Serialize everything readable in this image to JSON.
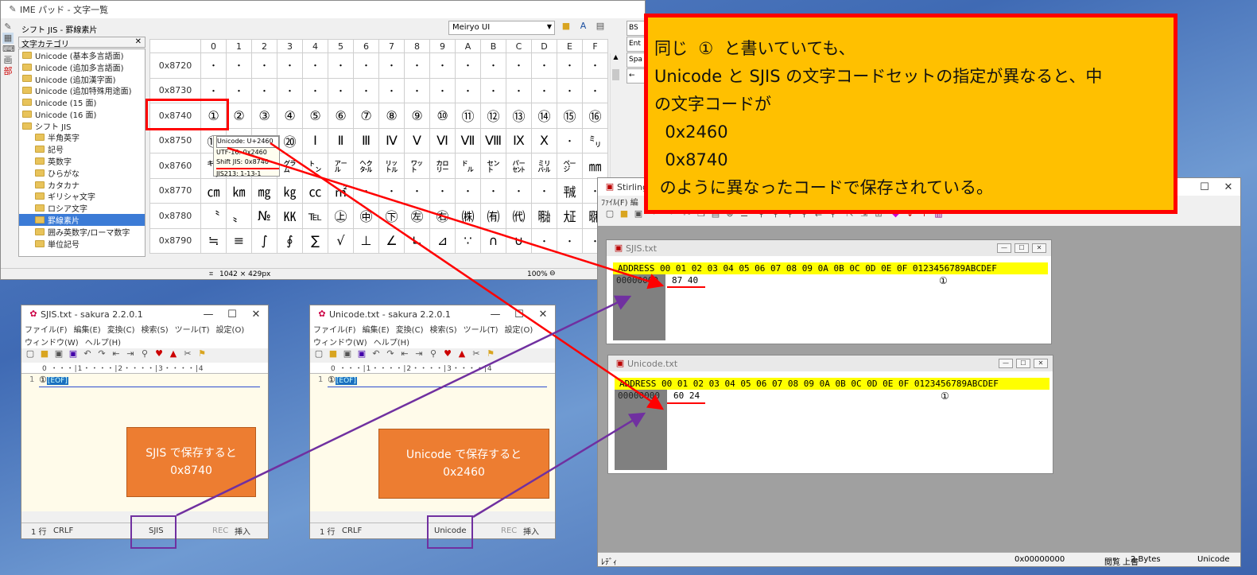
{
  "ime": {
    "title": "IME パッド - 文字一覧",
    "charset": "シフト JIS - 罫線素片",
    "font": "Meiryo UI",
    "category_header": "文字カテゴリ",
    "categories": [
      "Unicode (基本多言語面)",
      "Unicode (追加多言語面)",
      "Unicode (追加漢字面)",
      "Unicode (追加特殊用途面)",
      "Unicode (15 面)",
      "Unicode (16 面)",
      "シフト JIS",
      "半角英字",
      "記号",
      "英数字",
      "ひらがな",
      "カタカナ",
      "ギリシャ文字",
      "ロシア文字",
      "罫線素片",
      "囲み英数字/ローマ数字",
      "単位記号"
    ],
    "col_headers": [
      "0",
      "1",
      "2",
      "3",
      "4",
      "5",
      "6",
      "7",
      "8",
      "9",
      "A",
      "B",
      "C",
      "D",
      "E",
      "F"
    ],
    "rows": [
      {
        "addr": "0x8720",
        "chars": [
          "・",
          "・",
          "・",
          "・",
          "・",
          "・",
          "・",
          "・",
          "・",
          "・",
          "・",
          "・",
          "・",
          "・",
          "・",
          "・"
        ]
      },
      {
        "addr": "0x8730",
        "chars": [
          "・",
          "・",
          "・",
          "・",
          "・",
          "・",
          "・",
          "・",
          "・",
          "・",
          "・",
          "・",
          "・",
          "・",
          "・",
          "・"
        ]
      },
      {
        "addr": "0x8740",
        "chars": [
          "①",
          "②",
          "③",
          "④",
          "⑤",
          "⑥",
          "⑦",
          "⑧",
          "⑨",
          "⑩",
          "⑪",
          "⑫",
          "⑬",
          "⑭",
          "⑮",
          "⑯"
        ]
      },
      {
        "addr": "0x8750",
        "chars": [
          "⑰",
          "⑱",
          "⑲",
          "⑳",
          "Ⅰ",
          "Ⅱ",
          "Ⅲ",
          "Ⅳ",
          "Ⅴ",
          "Ⅵ",
          "Ⅶ",
          "Ⅷ",
          "Ⅸ",
          "Ⅹ",
          "・",
          "㍉"
        ]
      },
      {
        "addr": "0x8760",
        "chars": [
          "㌔",
          "㌢",
          "㍍",
          "㌘",
          "㌧",
          "㌃",
          "㌶",
          "㍑",
          "㍗",
          "㌍",
          "㌦",
          "㌣",
          "㌫",
          "㍊",
          "㌻",
          "㎜"
        ]
      },
      {
        "addr": "0x8770",
        "chars": [
          "㎝",
          "㎞",
          "㎎",
          "㎏",
          "㏄",
          "㎡",
          "・",
          "・",
          "・",
          "・",
          "・",
          "・",
          "・",
          "・",
          "㍻",
          "・"
        ]
      },
      {
        "addr": "0x8780",
        "chars": [
          "〝",
          "〟",
          "№",
          "㏍",
          "℡",
          "㊤",
          "㊥",
          "㊦",
          "㊧",
          "㊨",
          "㈱",
          "㈲",
          "㈹",
          "㍾",
          "㍽",
          "㍼"
        ]
      },
      {
        "addr": "0x8790",
        "chars": [
          "≒",
          "≡",
          "∫",
          "∮",
          "∑",
          "√",
          "⊥",
          "∠",
          "∟",
          "⊿",
          "∵",
          "∩",
          "∪",
          "・",
          "・",
          "・"
        ]
      }
    ],
    "tooltip": [
      "Unicode: U+2460",
      "UTF-16: 0x2460",
      "Shift JIS: 0x8740",
      "JIS213: 1-13-1"
    ],
    "right_keys": [
      "BS",
      "Ent",
      "Spa",
      "←"
    ],
    "status_size": "1042 × 429px",
    "status_zoom": "100%"
  },
  "sjis_editor": {
    "title": "SJIS.txt - sakura 2.2.0.1",
    "menu1": [
      "ファイル(F)",
      "編集(E)",
      "変換(C)",
      "検索(S)",
      "ツール(T)",
      "設定(O)"
    ],
    "menu2": [
      "ウィンドウ(W)",
      "ヘルプ(H)"
    ],
    "ruler": "0 ・・・|1・・・・|2・・・・|3・・・・|4",
    "line_no": "1",
    "line_text": "①",
    "eof": "[EOF]",
    "status_line": "1 行",
    "status_crlf": "CRLF",
    "status_enc": "SJIS",
    "status_rec": "REC",
    "status_ins": "挿入",
    "note_line1": "SJIS  で保存すると",
    "note_line2": "0x8740"
  },
  "unicode_editor": {
    "title": "Unicode.txt - sakura 2.2.0.1",
    "menu1": [
      "ファイル(F)",
      "編集(E)",
      "変換(C)",
      "検索(S)",
      "ツール(T)",
      "設定(O)"
    ],
    "menu2": [
      "ウィンドウ(W)",
      "ヘルプ(H)"
    ],
    "ruler": "0 ・・・|1・・・・|2・・・・|3・・・・|4",
    "line_no": "1",
    "line_text": "①",
    "eof": "[EOF]",
    "status_line": "1 行",
    "status_crlf": "CRLF",
    "status_enc": "Unicode",
    "status_rec": "REC",
    "status_ins": "挿入",
    "note_line1": "Unicode  で保存すると",
    "note_line2": "0x2460"
  },
  "stirling": {
    "title": "Stirling",
    "menu": "ﾌｧｲﾙ(F)  編",
    "sjis_win": {
      "title": "SJIS.txt",
      "header": "ADDRESS   00 01 02 03 04 05 06 07 08 09 0A 0B 0C 0D 0E 0F    0123456789ABCDEF",
      "addr": "00000000",
      "bytes": "87 40",
      "char": "①"
    },
    "unicode_win": {
      "title": "Unicode.txt",
      "header": "ADDRESS   00 01 02 03 04 05 06 07 08 09 0A 0B 0C 0D 0E 0F    0123456789ABCDEF",
      "addr": "00000000",
      "bytes": "60 24",
      "char": "①"
    },
    "status_ready": "ﾚﾃﾞｨ",
    "status_addr": "0x00000000",
    "status_mode1": "閲覧",
    "status_mode2": "上書",
    "status_bytes": "2 Bytes",
    "status_enc": "Unicode"
  },
  "explanation": [
    "同じ  ①  と書いていても、",
    "Unicode と SJIS の文字コードセットの指定が異なると、中",
    "の文字コードが",
    "  0x2460",
    "  0x8740",
    " のように異なったコードで保存されている。"
  ],
  "colors": {
    "highlight_red": "#ff0000",
    "explain_bg": "#ffc000",
    "note_orange": "#ed7d31",
    "purple": "#7030a0",
    "hex_yellow": "#ffff00"
  }
}
